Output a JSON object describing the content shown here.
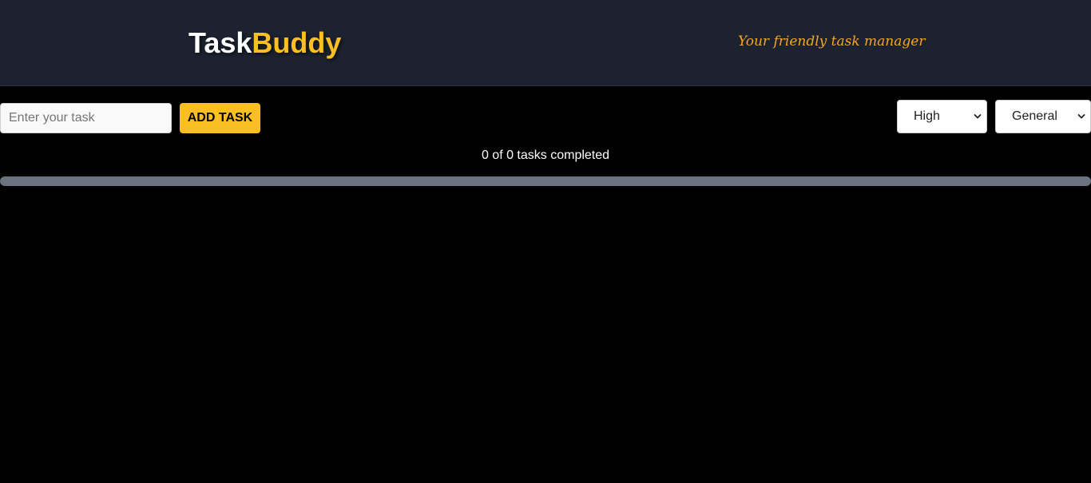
{
  "header": {
    "logo_part_1": "Task",
    "logo_part_2": "Buddy",
    "tagline": "Your friendly task manager"
  },
  "task_form": {
    "input_placeholder": "Enter your task",
    "input_value": "",
    "add_button_label": "ADD TASK",
    "priority_selected": "High",
    "category_selected": "General"
  },
  "progress": {
    "text": "0 of 0 tasks completed",
    "completed": 0,
    "total": 0,
    "fraction": 0
  },
  "colors": {
    "accent": "#fbbf24",
    "header_bg": "#1c2230",
    "page_bg": "#000000",
    "progress_track": "#6b7280"
  },
  "icons": {
    "dropdown": "chevron-down-icon"
  }
}
